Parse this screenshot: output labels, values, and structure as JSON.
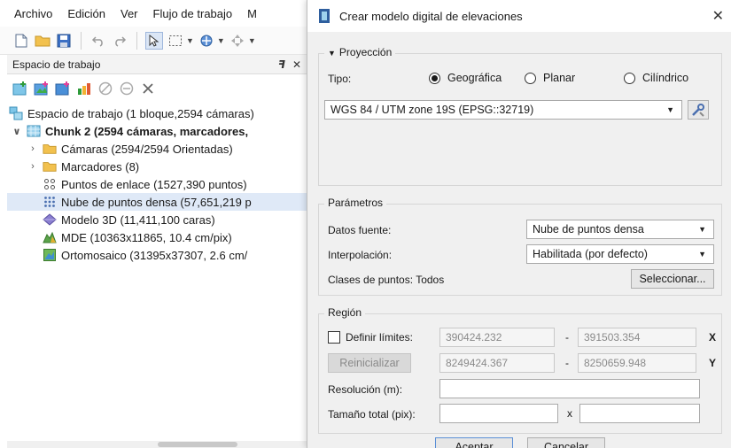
{
  "menubar": {
    "items": [
      "Archivo",
      "Edición",
      "Ver",
      "Flujo de trabajo",
      "M"
    ]
  },
  "workspace": {
    "title": "Espacio de trabajo",
    "tree": [
      {
        "label": "Espacio de trabajo (1 bloque,2594 cámaras)",
        "icon": "workspace-icon"
      },
      {
        "label": "Chunk 2 (2594 cámaras,  marcadores,",
        "icon": "chunk-icon"
      },
      {
        "label": "Cámaras (2594/2594 Orientadas)",
        "icon": "folder-icon"
      },
      {
        "label": "Marcadores (8)",
        "icon": "folder-icon"
      },
      {
        "label": "Puntos de enlace (1527,390 puntos)",
        "icon": "tie-points-icon"
      },
      {
        "label": "Nube de puntos densa (57,651,219 p",
        "icon": "dense-cloud-icon"
      },
      {
        "label": "Modelo 3D (11,411,100 caras)",
        "icon": "model-icon"
      },
      {
        "label": "MDE (10363x11865, 10.4 cm/pix)",
        "icon": "dem-icon"
      },
      {
        "label": "Ortomosaico (31395x37307, 2.6 cm/",
        "icon": "orthomosaic-icon"
      }
    ]
  },
  "dialog": {
    "title": "Crear modelo digital de elevaciones",
    "projection": {
      "header": "Proyección",
      "type_label": "Tipo:",
      "options": [
        "Geográfica",
        "Planar",
        "Cilíndrico"
      ],
      "selected": "Geográfica",
      "crs": "WGS 84 / UTM zone 19S (EPSG::32719)"
    },
    "parameters": {
      "header": "Parámetros",
      "source_label": "Datos fuente:",
      "source_value": "Nube de puntos densa",
      "interp_label": "Interpolación:",
      "interp_value": "Habilitada (por defecto)",
      "classes_label": "Clases de puntos:",
      "classes_value": "Todos",
      "select_button": "Seleccionar..."
    },
    "region": {
      "header": "Región",
      "set_limits": "Definir límites:",
      "reset_button": "Reinicializar",
      "x_min": "390424.232",
      "x_max": "391503.354",
      "y_min": "8249424.367",
      "y_max": "8250659.948",
      "dash": "-",
      "x_label": "X",
      "y_label": "Y",
      "resolution_label": "Resolución (m):",
      "resolution_value": "",
      "total_size_label": "Tamaño total (pix):",
      "size_x": "",
      "size_y": "",
      "times": "x"
    },
    "ok_button": "Aceptar",
    "cancel_button": "Cancelar"
  }
}
